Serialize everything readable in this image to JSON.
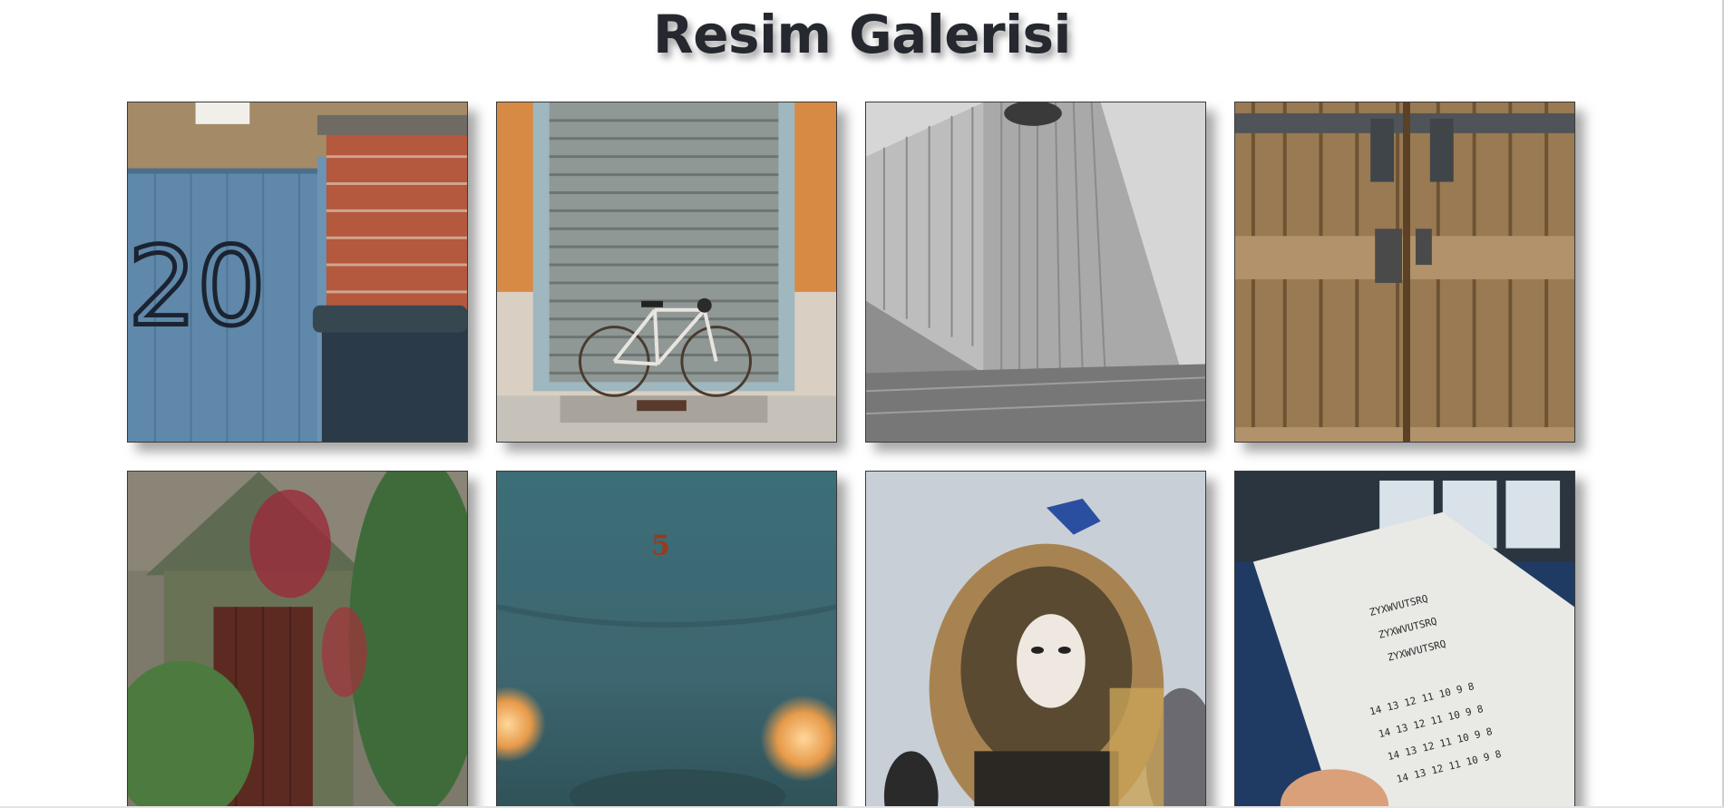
{
  "page": {
    "title": "Resim Galerisi"
  },
  "gallery": {
    "images": [
      {
        "subject": "blue-gate-brick-wall",
        "number_painted": "20"
      },
      {
        "subject": "bicycle-shutter-door"
      },
      {
        "subject": "grey-building"
      },
      {
        "subject": "old-wooden-door"
      },
      {
        "subject": "ivy-shed-door"
      },
      {
        "subject": "blurred-lights-teal",
        "figure": "5"
      },
      {
        "subject": "carnival-mask"
      },
      {
        "subject": "ticket-sheet-train"
      }
    ]
  },
  "colors": {
    "background": "#ffffff",
    "title": "#25282f"
  }
}
